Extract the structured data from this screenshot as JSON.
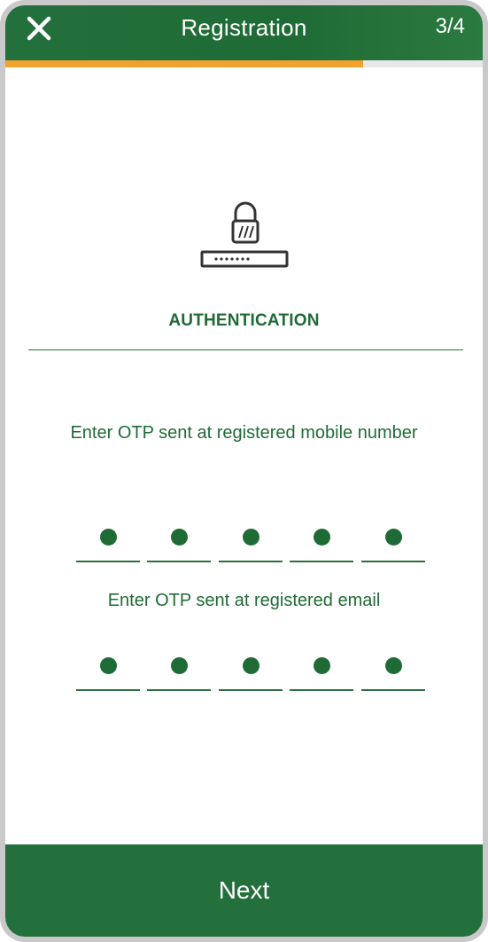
{
  "header": {
    "close_icon": "close-icon",
    "title": "Registration",
    "step": "3/4",
    "progress": 0.75,
    "progress_color": "#f0a22e"
  },
  "auth": {
    "icon": "lock-password-icon",
    "title": "AUTHENTICATION"
  },
  "mobile_otp": {
    "prompt": "Enter OTP sent at registered mobile number",
    "digits_filled": 5,
    "digit_count": 5
  },
  "email_otp": {
    "prompt": "Enter OTP sent at registered email",
    "digits_filled": 5,
    "digit_count": 5
  },
  "footer": {
    "next_label": "Next"
  },
  "colors": {
    "primary": "#1f6b36",
    "accent": "#f0a22e"
  }
}
